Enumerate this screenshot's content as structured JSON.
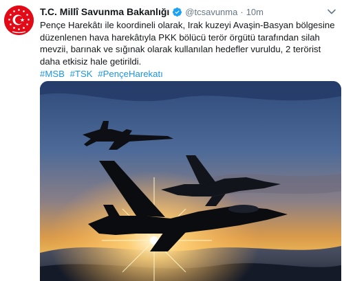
{
  "tweet": {
    "author_name": "T.C. Millî Savunma Bakanlığı",
    "handle": "@tcsavunma",
    "separator": "·",
    "time": "10m",
    "text": "Pençe Harekâtı ile koordineli olarak, Irak kuzeyi Avaşin-Basyan bölgesine düzenlenen hava harekâtıyla PKK bölücü terör örgütü tarafından silah mevzii, barınak ve sığınak olarak kullanılan hedefler vuruldu, 2 terörist daha etkisiz hale getirildi.",
    "hashtags": [
      "#MSB",
      "#TSK",
      "#PençeHarekatı"
    ]
  },
  "colors": {
    "avatar_red": "#e30a17",
    "verified_blue": "#1da1f2",
    "link_blue": "#1b95e0",
    "secondary_text": "#657786"
  },
  "icons": {
    "verified": "verified-badge-icon",
    "menu": "chevron-down-icon",
    "avatar_emblem": "turkish-flag-emblem-icon"
  }
}
